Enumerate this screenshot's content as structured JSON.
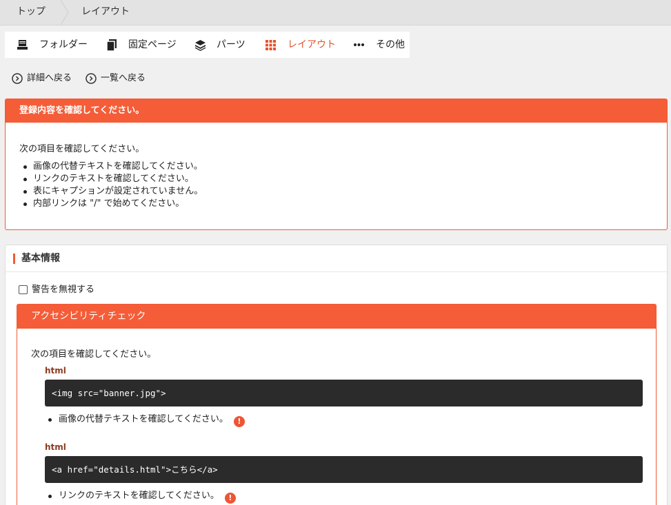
{
  "breadcrumb": {
    "items": [
      "トップ",
      "レイアウト"
    ]
  },
  "nav": {
    "items": [
      {
        "label": "フォルダー",
        "icon": "folder-icon"
      },
      {
        "label": "固定ページ",
        "icon": "pages-icon"
      },
      {
        "label": "パーツ",
        "icon": "layers-icon"
      },
      {
        "label": "レイアウト",
        "icon": "grid-icon",
        "active": true
      },
      {
        "label": "その他",
        "icon": "more-icon"
      }
    ]
  },
  "back_links": {
    "detail": "詳細へ戻る",
    "list": "一覧へ戻る"
  },
  "alert": {
    "title": "登録内容を確認してください。",
    "intro": "次の項目を確認してください。",
    "items": [
      "画像の代替テキストを確認してください。",
      "リンクのテキストを確認してください。",
      "表にキャプションが設定されていません。",
      "内部リンクは \"/\" で始めてください。"
    ]
  },
  "panel": {
    "title": "基本情報",
    "ignore_label": "警告を無視する",
    "ignore_checked": false,
    "accessibility": {
      "title": "アクセシビリティチェック",
      "intro": "次の項目を確認してください。",
      "issues": [
        {
          "lang": "html",
          "code": "<img src=\"banner.jpg\">",
          "message": "画像の代替テキストを確認してください。"
        },
        {
          "lang": "html",
          "code": "<a href=\"details.html\">こちら</a>",
          "message": "リンクのテキストを確認してください。"
        }
      ]
    }
  },
  "colors": {
    "accent": "#f45d38",
    "code_bg": "#2b2b2b",
    "active_nav": "#e5532d"
  }
}
